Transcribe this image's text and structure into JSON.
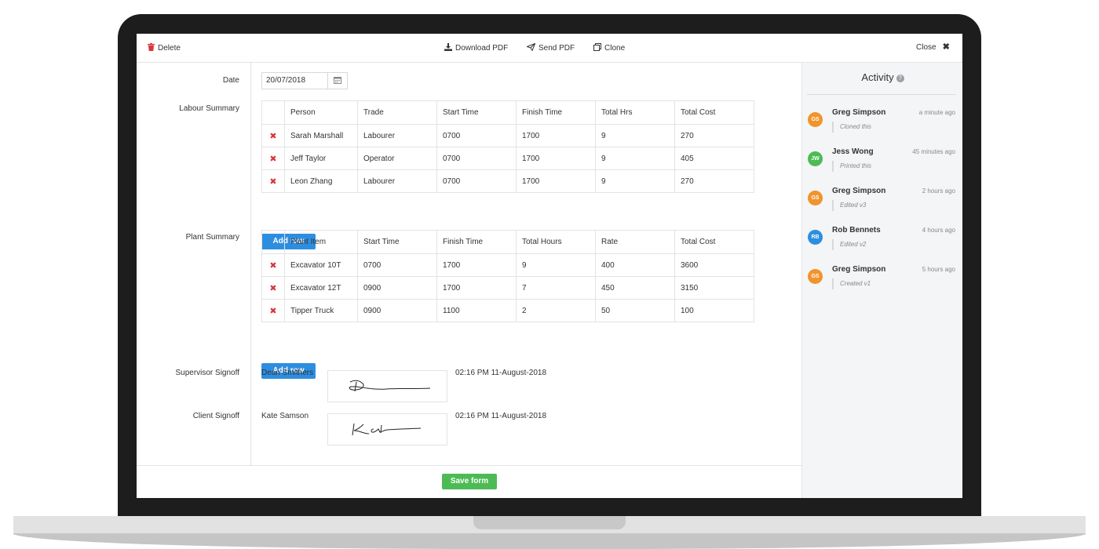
{
  "toolbar": {
    "delete": "Delete",
    "download_pdf": "Download PDF",
    "send_pdf": "Send PDF",
    "clone": "Clone",
    "close": "Close"
  },
  "form": {
    "date_label": "Date",
    "date_value": "20/07/2018",
    "labour_label": "Labour Summary",
    "labour": {
      "headers": [
        "Person",
        "Trade",
        "Start Time",
        "Finish Time",
        "Total Hrs",
        "Total Cost"
      ],
      "rows": [
        [
          "Sarah Marshall",
          "Labourer",
          "0700",
          "1700",
          "9",
          "270"
        ],
        [
          "Jeff Taylor",
          "Operator",
          "0700",
          "1700",
          "9",
          "405"
        ],
        [
          "Leon Zhang",
          "Labourer",
          "0700",
          "1700",
          "9",
          "270"
        ]
      ]
    },
    "plant_label": "Plant Summary",
    "plant": {
      "headers": [
        "Plant Item",
        "Start Time",
        "Finish Time",
        "Total Hours",
        "Rate",
        "Total Cost"
      ],
      "rows": [
        [
          "Excavator 10T",
          "0700",
          "1700",
          "9",
          "400",
          "3600"
        ],
        [
          "Excavator 12T",
          "0900",
          "1700",
          "7",
          "450",
          "3150"
        ],
        [
          "Tipper Truck",
          "0900",
          "1100",
          "2",
          "50",
          "100"
        ]
      ]
    },
    "add_row": "Add row",
    "supervisor_label": "Supervisor Signoff",
    "supervisor_name": "Dean Smithers",
    "supervisor_time": "02:16 PM 11-August-2018",
    "client_label": "Client Signoff",
    "client_name": "Kate Samson",
    "client_time": "02:16 PM 11-August-2018",
    "save": "Save form"
  },
  "activity": {
    "title": "Activity",
    "items": [
      {
        "initials": "GS",
        "name": "Greg Simpson",
        "time": "a minute ago",
        "note": "Cloned this",
        "color": "#f0942d"
      },
      {
        "initials": "JW",
        "name": "Jess Wong",
        "time": "45 minutes ago",
        "note": "Printed this",
        "color": "#4cbb55"
      },
      {
        "initials": "GS",
        "name": "Greg Simpson",
        "time": "2 hours ago",
        "note": "Edited v3",
        "color": "#f0942d"
      },
      {
        "initials": "RB",
        "name": "Rob Bennets",
        "time": "4 hours ago",
        "note": "Edited v2",
        "color": "#2d8ee0"
      },
      {
        "initials": "GS",
        "name": "Greg Simpson",
        "time": "5 hours ago",
        "note": "Created v1",
        "color": "#f0942d"
      }
    ]
  },
  "colors": {
    "accent_blue": "#2d8ee0",
    "save_green": "#4cbb55",
    "delete_red": "#d9363e"
  }
}
